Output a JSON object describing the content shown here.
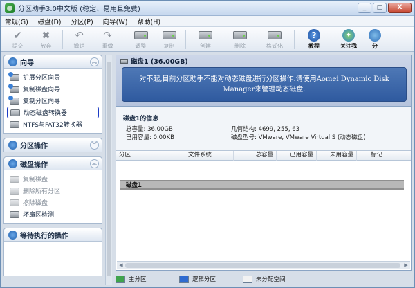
{
  "window": {
    "title": "分区助手3.0中文版 (稳定、易用且免费)",
    "minimize": "_",
    "maximize": "□",
    "close": "X"
  },
  "menu": [
    "常规(G)",
    "磁盘(D)",
    "分区(P)",
    "向导(W)",
    "帮助(H)"
  ],
  "toolbar": {
    "submit": "提交",
    "discard": "放弃",
    "undo": "撤销",
    "redo": "重做",
    "resize": "调整",
    "copy": "复制",
    "create": "创建",
    "delete": "删除",
    "format": "格式化",
    "tutorial": "教程",
    "about": "关注我",
    "partition": "分"
  },
  "left": {
    "wizard": {
      "title": "向导",
      "items": [
        "扩展分区向导",
        "复制磁盘向导",
        "复制分区向导",
        "动态磁盘转换器",
        "NTFS与FAT32转换器"
      ]
    },
    "partition_ops": {
      "title": "分区操作"
    },
    "disk_ops": {
      "title": "磁盘操作",
      "items": [
        "复制磁盘",
        "删除所有分区",
        "擦除磁盘",
        "坏扇区检测"
      ]
    },
    "pending": {
      "title": "等待执行的操作"
    }
  },
  "banner": {
    "disk_label": "磁盘1 (36.00GB)",
    "notice": "对不起,目前分区助手不能对动态磁盘进行分区操作.请使用Aomei Dynamic Disk Manager来管理动态磁盘."
  },
  "info": {
    "title": "磁盘1的信息",
    "total": "总容量: 36.00GB",
    "used": "已用容量: 0.00KB",
    "geometry": "几何结构: 4699, 255, 63",
    "model": "磁盘型号: VMware, VMware Virtual S (动态磁盘)"
  },
  "table": {
    "headers": [
      "分区",
      "文件系统",
      "总容量",
      "已用容量",
      "未用容量",
      "标记"
    ],
    "disk_row": "磁盘1"
  },
  "legend": [
    {
      "label": "主分区",
      "color": "#3fa34d"
    },
    {
      "label": "逻辑分区",
      "color": "#2f6bd0"
    },
    {
      "label": "未分配空间",
      "color": "#f2f2f2"
    }
  ]
}
